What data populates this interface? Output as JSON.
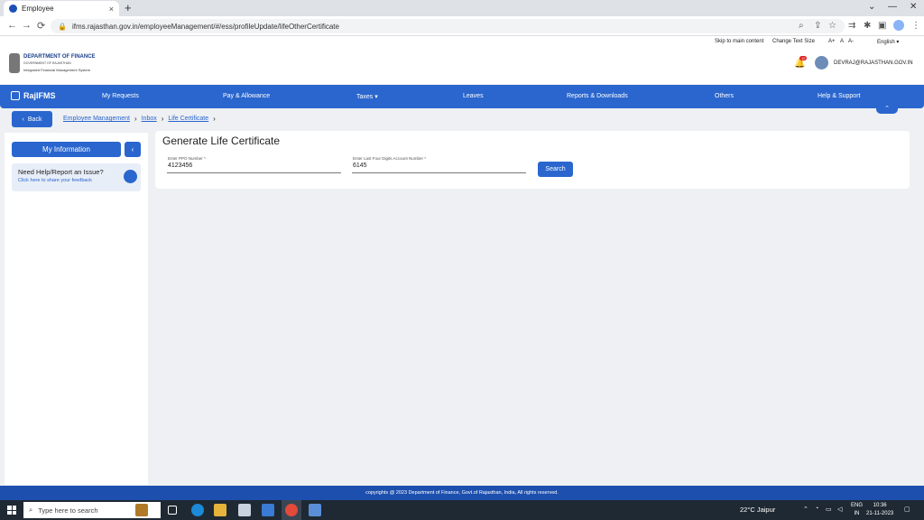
{
  "browser": {
    "tab_title": "Employee",
    "tab_close": "×",
    "new_tab": "+",
    "url": "ifms.rajasthan.gov.in/employeeManagement/#/ess/profileUpdate/lifeOtherCertificate"
  },
  "utility": {
    "skip": "Skip to main content",
    "change_text": "Change Text Size",
    "a_plus": "A+",
    "a": "A",
    "a_minus": "A-",
    "language": "English ▾"
  },
  "header": {
    "dept": "DEPARTMENT OF FINANCE",
    "govt": "GOVERNMENT OF RAJASTHAN",
    "system": "Integrated Financial Management System",
    "notif_count": "12",
    "user_email": "DEVRAJ@RAJASTHAN.GOV.IN"
  },
  "nav": {
    "brand": "RajIFMS",
    "items": [
      {
        "label": "My Requests"
      },
      {
        "label": "Pay & Allowance"
      },
      {
        "label": "Taxes ▾"
      },
      {
        "label": "Leaves"
      },
      {
        "label": "Reports & Downloads"
      },
      {
        "label": "Others"
      },
      {
        "label": "Help & Support"
      }
    ]
  },
  "breadcrumb": {
    "back": "Back",
    "items": [
      "Employee Management",
      "Inbox",
      "Life Certificate"
    ]
  },
  "sidebar": {
    "my_info": "My Information",
    "help_title": "Need Help/Report an Issue?",
    "help_sub": "Click here to share your feedback"
  },
  "form": {
    "title": "Generate Life Certificate",
    "ppo_label": "Enter PPO Number *",
    "ppo_value": "4123456",
    "acct_label": "Enter Last Four Digits Account Number *",
    "acct_value": "6145",
    "search": "Search"
  },
  "footer": {
    "text": "copyrights @ 2023 Department of Finance, Govt.of Rajasthan, India, All rights reserved."
  },
  "taskbar": {
    "search_placeholder": "Type here to search",
    "weather": "22°C  Jaipur",
    "lang1": "ENG",
    "lang2": "IN",
    "time": "10:36",
    "date": "21-11-2023"
  }
}
